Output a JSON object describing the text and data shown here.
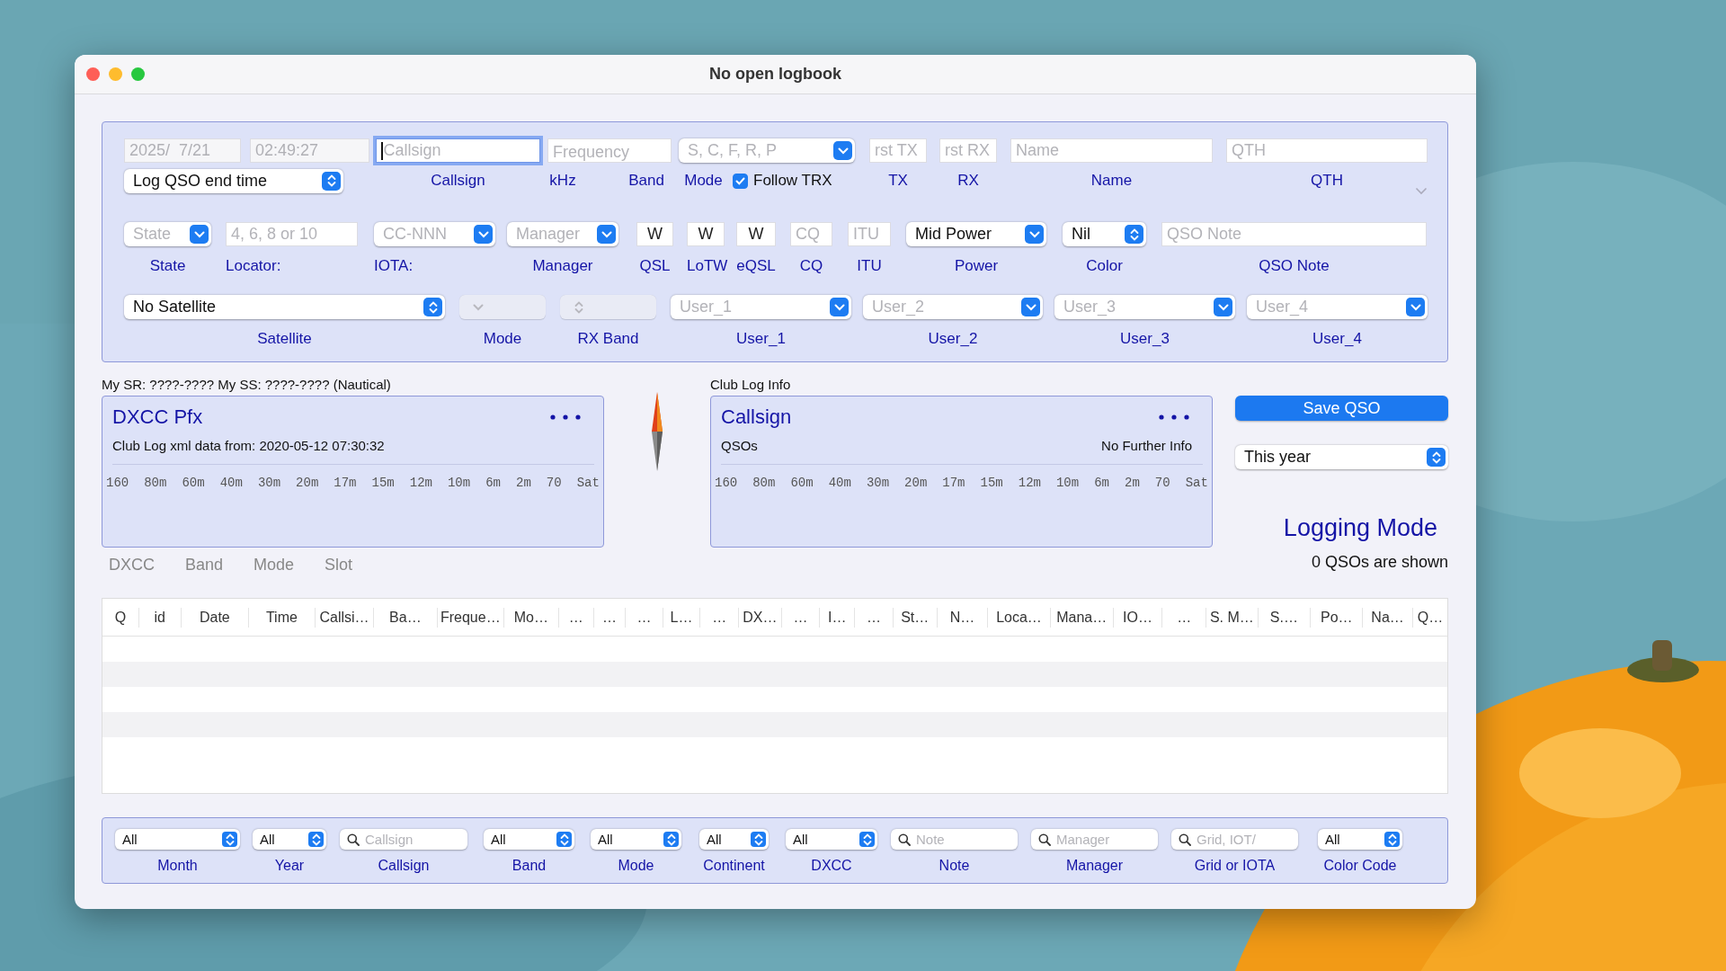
{
  "window": {
    "title": "No open logbook"
  },
  "row_1": {
    "controls": [
      {
        "kind": "field",
        "value": "2025/  7/21",
        "disabled": true
      },
      {
        "kind": "field",
        "value": "02:49:27",
        "disabled": true
      },
      {
        "kind": "field",
        "placeholder": "Callsign",
        "focused": true
      },
      {
        "kind": "field",
        "placeholder": "Frequency"
      },
      {
        "kind": "combo",
        "placeholder": "S, C, F, R, P"
      },
      {
        "kind": "field",
        "placeholder": "rst TX"
      },
      {
        "kind": "field",
        "placeholder": "rst RX"
      },
      {
        "kind": "field",
        "placeholder": "Name"
      },
      {
        "kind": "field",
        "placeholder": "QTH"
      }
    ],
    "below": [
      {
        "kind": "popup",
        "value": "Log QSO end time"
      },
      {
        "kind": "label",
        "text": "Callsign"
      },
      {
        "kind": "label",
        "text": "kHz"
      },
      {
        "kind": "label",
        "text": "Band"
      },
      {
        "kind": "label",
        "text": "Mode"
      },
      {
        "kind": "checkbox",
        "text": "Follow TRX",
        "checked": true
      },
      {
        "kind": "label",
        "text": "TX"
      },
      {
        "kind": "label",
        "text": "RX"
      },
      {
        "kind": "label",
        "text": "Name"
      },
      {
        "kind": "label",
        "text": "QTH"
      }
    ]
  },
  "row_2": [
    {
      "kind": "combo",
      "placeholder": "State",
      "label": "State"
    },
    {
      "kind": "field",
      "placeholder": "4, 6, 8 or 10",
      "label": "Locator:"
    },
    {
      "kind": "combo",
      "placeholder": "CC-NNN",
      "label": "IOTA:"
    },
    {
      "kind": "combo",
      "placeholder": "Manager",
      "label": "Manager"
    },
    {
      "kind": "field",
      "value": "W",
      "label": "QSL"
    },
    {
      "kind": "field",
      "value": "W",
      "label": "LoTW"
    },
    {
      "kind": "field",
      "value": "W",
      "label": "eQSL"
    },
    {
      "kind": "field",
      "placeholder": "CQ",
      "label": "CQ"
    },
    {
      "kind": "field",
      "placeholder": "ITU",
      "label": "ITU"
    },
    {
      "kind": "combo",
      "value": "Mid Power",
      "label": "Power"
    },
    {
      "kind": "popup",
      "value": "Nil",
      "label": "Color"
    },
    {
      "kind": "field",
      "placeholder": "QSO Note",
      "label": "QSO Note"
    }
  ],
  "row_3": [
    {
      "kind": "popup",
      "value": "No Satellite",
      "label": "Satellite"
    },
    {
      "kind": "combo",
      "disabled": true,
      "label": "Mode"
    },
    {
      "kind": "popup",
      "disabled": true,
      "label": "RX Band"
    },
    {
      "kind": "combo",
      "placeholder": "User_1",
      "label": "User_1"
    },
    {
      "kind": "combo",
      "placeholder": "User_2",
      "label": "User_2"
    },
    {
      "kind": "combo",
      "placeholder": "User_3",
      "label": "User_3"
    },
    {
      "kind": "combo",
      "placeholder": "User_4",
      "label": "User_4"
    }
  ],
  "sun_times": "My SR: ????-????  My SS: ????-???? (Nautical)",
  "dxcc_panel": {
    "title": "DXCC Pfx",
    "info": "Club Log xml data from: 2020-05-12 07:30:32",
    "bands": [
      "160",
      "80m",
      "60m",
      "40m",
      "30m",
      "20m",
      "17m",
      "15m",
      "12m",
      "10m",
      "6m",
      "2m",
      "70",
      "Sat"
    ]
  },
  "club_log": {
    "heading": "Club Log Info",
    "title": "Callsign",
    "left": "QSOs",
    "right": "No Further Info",
    "bands": [
      "160",
      "80m",
      "60m",
      "40m",
      "30m",
      "20m",
      "17m",
      "15m",
      "12m",
      "10m",
      "6m",
      "2m",
      "70",
      "Sat"
    ]
  },
  "save_button": "Save QSO",
  "period_popup": {
    "kind": "popup",
    "value": "This year"
  },
  "mode_title": "Logging Mode",
  "qso_count": "0 QSOs are shown",
  "tabs": [
    {
      "label": "DXCC",
      "selected": false
    },
    {
      "label": "Band",
      "selected": false
    },
    {
      "label": "Mode",
      "selected": false
    },
    {
      "label": "Slot",
      "selected": false
    }
  ],
  "table": {
    "columns": [
      "Q",
      "id",
      "Date",
      "Time",
      "Callsi…",
      "Ba…",
      "Freque…",
      "Mo…",
      "…",
      "…",
      "…",
      "L…",
      "…",
      "DX…",
      "…",
      "I…",
      "…",
      "St…",
      "N…",
      "Loca…",
      "Mana…",
      "IO…",
      "…",
      "S. M…",
      "S.…",
      "Po…",
      "Na…",
      "Q…"
    ]
  },
  "filters": [
    {
      "kind": "popup",
      "value": "All",
      "label": "Month"
    },
    {
      "kind": "popup",
      "value": "All",
      "label": "Year"
    },
    {
      "kind": "search",
      "placeholder": "Callsign",
      "label": "Callsign"
    },
    {
      "kind": "popup",
      "value": "All",
      "label": "Band"
    },
    {
      "kind": "popup",
      "value": "All",
      "label": "Mode"
    },
    {
      "kind": "popup",
      "value": "All",
      "label": "Continent"
    },
    {
      "kind": "popup",
      "value": "All",
      "label": "DXCC"
    },
    {
      "kind": "search",
      "placeholder": "Note",
      "label": "Note"
    },
    {
      "kind": "search",
      "placeholder": "Manager",
      "label": "Manager"
    },
    {
      "kind": "search",
      "placeholder": "Grid, IOT/",
      "label": "Grid or IOTA"
    },
    {
      "kind": "popup",
      "value": "All",
      "label": "Color Code"
    }
  ]
}
